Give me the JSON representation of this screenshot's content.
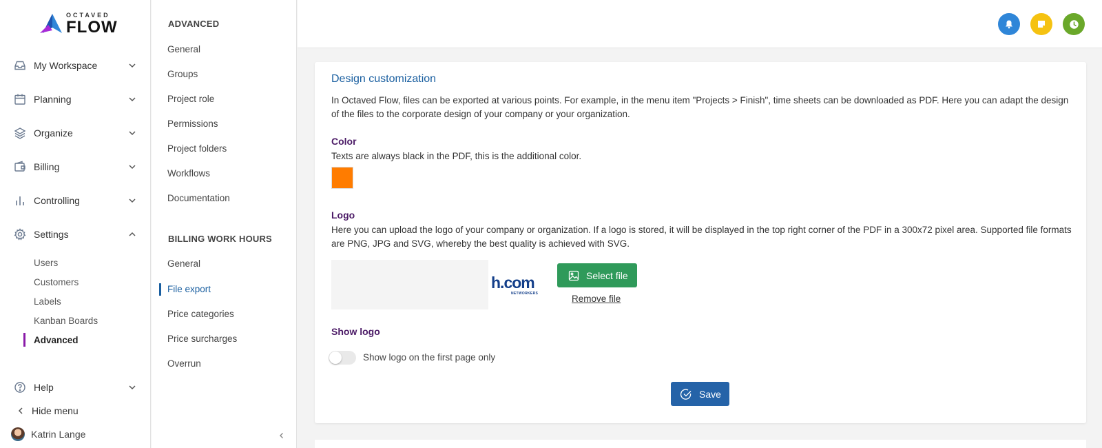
{
  "brand": {
    "small": "OCTAVED",
    "big": "FLOW"
  },
  "sidebar": {
    "items": [
      {
        "label": "My Workspace",
        "icon": "inbox-icon"
      },
      {
        "label": "Planning",
        "icon": "calendar-icon"
      },
      {
        "label": "Organize",
        "icon": "layers-icon"
      },
      {
        "label": "Billing",
        "icon": "wallet-icon"
      },
      {
        "label": "Controlling",
        "icon": "bar-chart-icon"
      },
      {
        "label": "Settings",
        "icon": "gear-icon"
      }
    ],
    "settings_sub": [
      "Users",
      "Customers",
      "Labels",
      "Kanban Boards",
      "Advanced"
    ],
    "help": "Help",
    "hide_menu": "Hide menu",
    "user_name": "Katrin Lange"
  },
  "subnav": {
    "advanced_heading": "ADVANCED",
    "advanced_links": [
      "General",
      "Groups",
      "Project role",
      "Permissions",
      "Project folders",
      "Workflows",
      "Documentation"
    ],
    "billing_heading": "BILLING WORK HOURS",
    "billing_links": [
      "General",
      "File export",
      "Price categories",
      "Price surcharges",
      "Overrun"
    ]
  },
  "topbar": {
    "notification_color": "#2f86d8",
    "notes_color": "#f5c211",
    "clock_color": "#6aa82a"
  },
  "card": {
    "title": "Design customization",
    "description": "In Octaved Flow, files can be exported at various points. For example, in the menu item \"Projects > Finish\", time sheets can be downloaded as PDF. Here you can adapt the design of the files to the corporate design of your company or your organization.",
    "color_label": "Color",
    "color_desc": "Texts are always black in the PDF, this is the additional color.",
    "color_value": "#ff7c00",
    "logo_label": "Logo",
    "logo_desc": "Here you can upload the logo of your company or organization. If a logo is stored, it will be displayed in the top right corner of the PDF in a 300x72 pixel area. Supported file formats are PNG, JPG and SVG, whereby the best quality is achieved with SVG.",
    "logo_preview_text": "h.com",
    "logo_preview_sub": "NETWORKERS",
    "select_file": "Select file",
    "remove_file": "Remove file",
    "show_logo_label": "Show logo",
    "show_logo_toggle": "Show logo on the first page only",
    "show_logo_enabled": false,
    "save": "Save"
  }
}
